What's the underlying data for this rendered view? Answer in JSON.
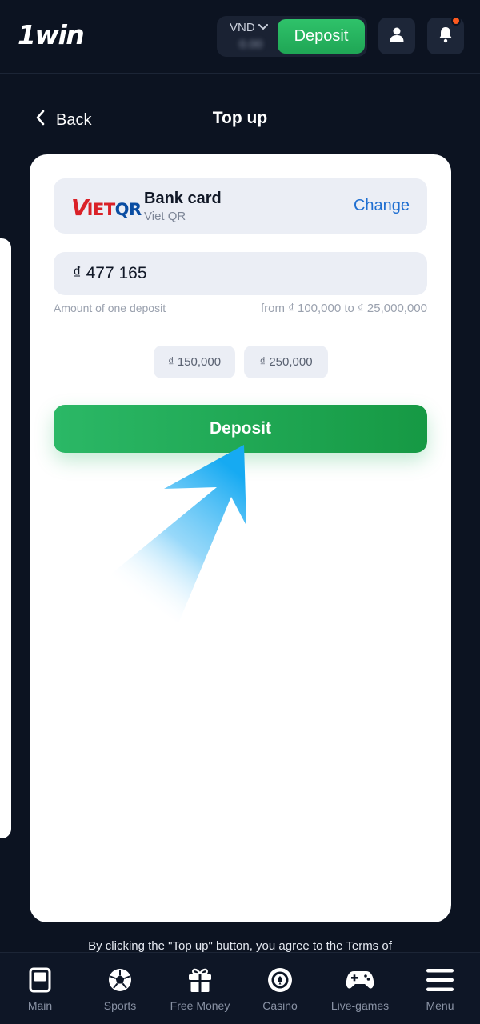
{
  "header": {
    "logo": "1win",
    "currency": "VND",
    "balance": "0.00",
    "deposit_label": "Deposit"
  },
  "page": {
    "back_label": "Back",
    "title": "Top up"
  },
  "payment_method": {
    "logo_text": "VIETQR",
    "title": "Bank card",
    "subtitle": "Viet QR",
    "change_label": "Change"
  },
  "amount": {
    "value": "₫ 477 165",
    "hint": "Amount of one deposit",
    "range": "from ₫ 100,000 to ₫ 25,000,000",
    "presets": [
      "₫ 150,000",
      "₫ 250,000"
    ]
  },
  "deposit_button": "Deposit",
  "terms_text": "By clicking the \"Top up\" button, you agree to the Terms of",
  "bottom_nav": [
    {
      "label": "Main",
      "icon": "main-icon"
    },
    {
      "label": "Sports",
      "icon": "soccer-ball-icon"
    },
    {
      "label": "Free Money",
      "icon": "gift-icon"
    },
    {
      "label": "Casino",
      "icon": "casino-chip-icon"
    },
    {
      "label": "Live-games",
      "icon": "gamepad-icon"
    },
    {
      "label": "Menu",
      "icon": "hamburger-icon"
    }
  ],
  "colors": {
    "background": "#0c1321",
    "accent_green": "#1fa655",
    "link_blue": "#1f6fd1",
    "notification": "#ff5a1f",
    "arrow_blue": "#1ab0f5"
  }
}
